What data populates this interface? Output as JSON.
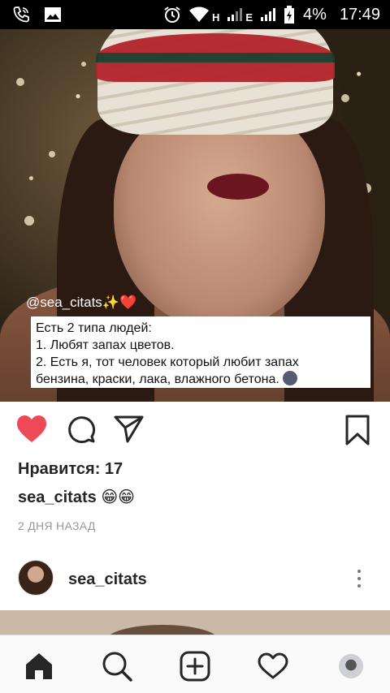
{
  "status_bar": {
    "network_1": "H",
    "network_2": "E",
    "battery": "4%",
    "time": "17:49"
  },
  "post": {
    "overlay_handle": "@sea_citats",
    "overlay_handle_emojis": "✨❤️",
    "quote_lines": [
      "Есть 2 типа людей:",
      "1. Любят запах цветов.",
      "2. Есть я, тот человек который любит запах",
      "бензина, краски, лака, влажного бетона."
    ],
    "likes_text": "Нравится: 17",
    "caption_user": "sea_citats",
    "caption_emojis": "😁😁",
    "timestamp": "2 ДНЯ НАЗАД",
    "liked": true,
    "accent_color": "#ed4956"
  },
  "next_post": {
    "username": "sea_citats"
  },
  "nav": {
    "items": [
      "home-icon",
      "search-icon",
      "add-post-icon",
      "activity-icon",
      "profile-avatar"
    ]
  }
}
